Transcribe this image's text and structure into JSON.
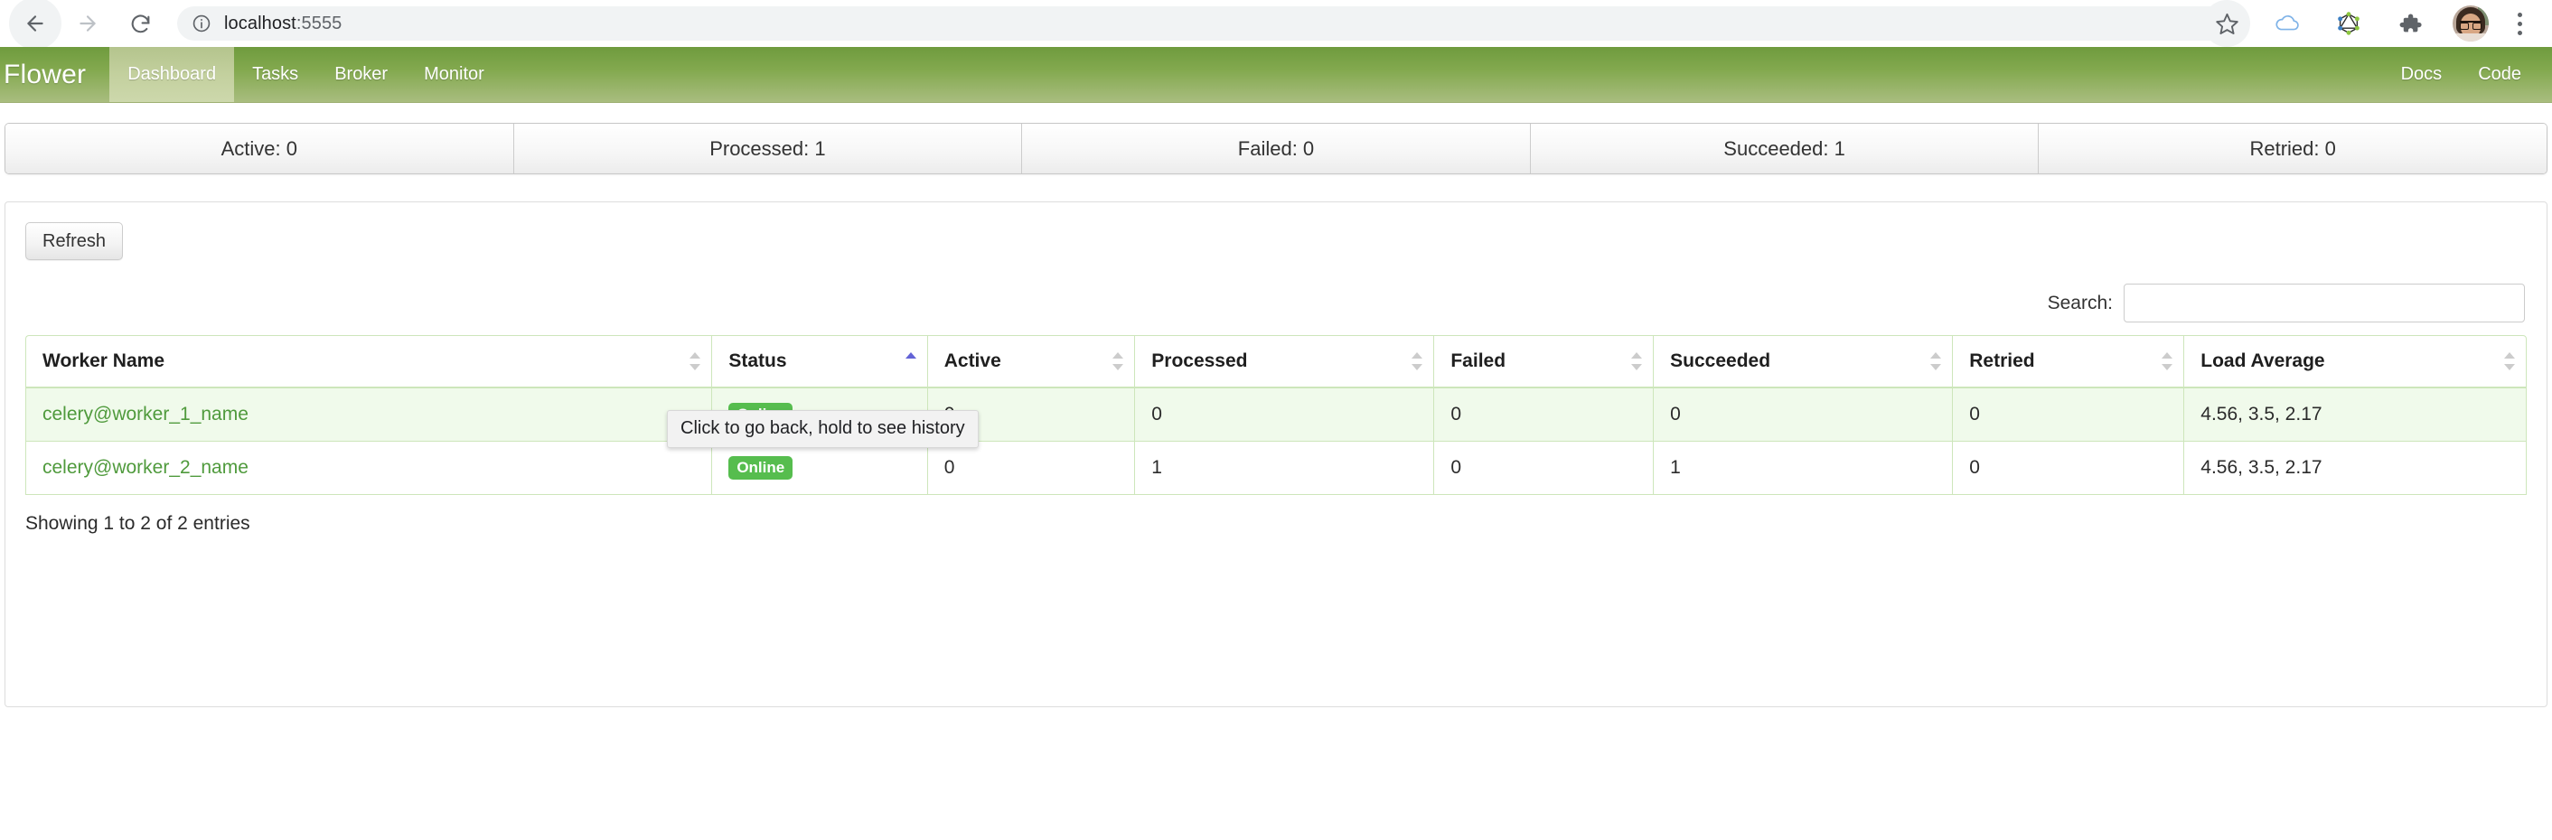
{
  "browser": {
    "back_label": "back-arrow",
    "forward_label": "forward-arrow",
    "reload_label": "reload",
    "url": "localhost",
    "url_port": ":5555",
    "icons": [
      "info-icon",
      "star-icon",
      "cloud-icon",
      "graphql-icon",
      "puzzle-icon",
      "avatar",
      "kebab-menu-icon"
    ],
    "back_tooltip": "Click to go back, hold to see history"
  },
  "navbar": {
    "brand": "Flower",
    "links": [
      {
        "label": "Dashboard",
        "active": true
      },
      {
        "label": "Tasks",
        "active": false
      },
      {
        "label": "Broker",
        "active": false
      },
      {
        "label": "Monitor",
        "active": false
      }
    ],
    "right_links": [
      {
        "label": "Docs"
      },
      {
        "label": "Code"
      }
    ]
  },
  "stats": [
    {
      "label": "Active: 0"
    },
    {
      "label": "Processed: 1"
    },
    {
      "label": "Failed: 0"
    },
    {
      "label": "Succeeded: 1"
    },
    {
      "label": "Retried: 0"
    }
  ],
  "panel": {
    "refresh_label": "Refresh",
    "search_label": "Search:",
    "search_value": "",
    "search_placeholder": ""
  },
  "table": {
    "columns": [
      {
        "label": "Worker Name",
        "sort": "none"
      },
      {
        "label": "Status",
        "sort": "asc"
      },
      {
        "label": "Active",
        "sort": "none"
      },
      {
        "label": "Processed",
        "sort": "none"
      },
      {
        "label": "Failed",
        "sort": "none"
      },
      {
        "label": "Succeeded",
        "sort": "none"
      },
      {
        "label": "Retried",
        "sort": "none"
      },
      {
        "label": "Load Average",
        "sort": "none"
      }
    ],
    "rows": [
      {
        "worker_name": "celery@worker_1_name",
        "status": "Online",
        "active": "0",
        "processed": "0",
        "failed": "0",
        "succeeded": "0",
        "retried": "0",
        "load_average": "4.56, 3.5, 2.17"
      },
      {
        "worker_name": "celery@worker_2_name",
        "status": "Online",
        "active": "0",
        "processed": "1",
        "failed": "0",
        "succeeded": "1",
        "retried": "0",
        "load_average": "4.56, 3.5, 2.17"
      }
    ],
    "info": "Showing 1 to 2 of 2 entries"
  },
  "colors": {
    "navbar_dark": "#6f9b3e",
    "navbar_light": "#a9bd7f",
    "active_tab": "#c3d09e",
    "link_green": "#4f9a3c",
    "badge_green": "#56bd4e",
    "table_border": "#cde6bb",
    "row_stripe": "#f0faeb",
    "sort_active": "#6363d6"
  }
}
